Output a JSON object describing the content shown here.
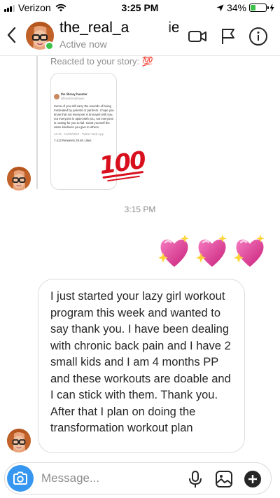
{
  "status_bar": {
    "carrier": "Verizon",
    "time": "3:25 PM",
    "battery": "34%",
    "battery_level": 0.34
  },
  "header": {
    "username": "the_real_a",
    "username_tail": "ie",
    "presence": "Active now"
  },
  "conversation": {
    "story_reaction": {
      "label": "Reacted to your story: 💯",
      "reaction_emoji": "💯",
      "tweet": {
        "author": "the library haunter",
        "handle": "@bookmeghayes",
        "body": "Some of you still carry the wounds of being mistreated by parents or partners. I hope you know that not everyone is annoyed with you, not everyone is upset with you, not everyone is rooting for you to fail. Grant yourself the same kindness you give to others.",
        "meta": "14:15 · 10/29/2019 · Twitter Web App",
        "retweets": "7,413 Retweets",
        "likes": "29.4K Likes"
      }
    },
    "timestamp": "3:15 PM",
    "hearts": [
      "💖",
      "💖",
      "💖"
    ],
    "message": "I just started your lazy girl workout program this week and wanted to say thank you. I have been dealing with chronic back pain and I have 2 small kids and I am 4 months PP and these workouts are doable and I can stick with them. Thank you. After that I plan on doing the transformation workout plan"
  },
  "composer": {
    "placeholder": "Message..."
  },
  "colors": {
    "accent": "#3797f0",
    "online": "#3cc14b",
    "reaction_red": "#d8101e",
    "heart_pink": "#e8409a"
  },
  "icons": {
    "back": "chevron-left-icon",
    "video": "video-camera-icon",
    "flag": "flag-icon",
    "info": "info-icon",
    "camera": "camera-icon",
    "mic": "microphone-icon",
    "gallery": "gallery-icon",
    "add": "plus-circle-icon"
  }
}
